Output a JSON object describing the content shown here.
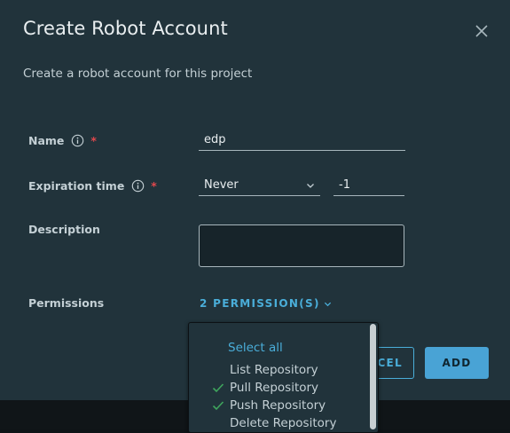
{
  "dialog": {
    "title": "Create Robot Account",
    "subtitle": "Create a robot account for this project"
  },
  "form": {
    "name": {
      "label": "Name",
      "required_mark": "*",
      "value": "edp"
    },
    "expiration": {
      "label": "Expiration time",
      "required_mark": "*",
      "unit_selected": "Never",
      "value": "-1"
    },
    "description": {
      "label": "Description",
      "value": ""
    },
    "permissions": {
      "label": "Permissions",
      "summary": "2 PERMISSION(S)"
    }
  },
  "buttons": {
    "cancel": "CANCEL",
    "add": "ADD"
  },
  "dropdown": {
    "select_all": "Select all",
    "items": [
      {
        "label": "List Repository",
        "checked": false
      },
      {
        "label": "Pull Repository",
        "checked": true
      },
      {
        "label": "Push Repository",
        "checked": true
      },
      {
        "label": "Delete Repository",
        "checked": false
      }
    ]
  },
  "colors": {
    "accent": "#4aaed9",
    "required": "#e0484d",
    "check": "#3fa55d",
    "panel": "#21333b"
  },
  "icons": {
    "close": "close-icon",
    "info": "info-icon",
    "chevron": "chevron-down-icon",
    "check": "check-icon"
  }
}
